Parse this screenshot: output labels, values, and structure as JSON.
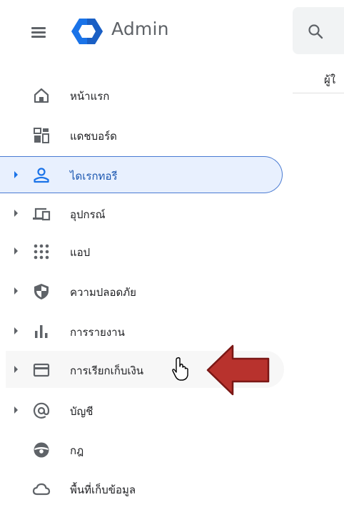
{
  "header": {
    "app_title": "Admin",
    "right_label": "ผู้ใ"
  },
  "sidebar": {
    "items": [
      {
        "label": "หน้าแรก",
        "icon": "home-icon",
        "expandable": false
      },
      {
        "label": "แดชบอร์ด",
        "icon": "dashboard-icon",
        "expandable": false
      },
      {
        "label": "ไดเรกทอรี",
        "icon": "person-icon",
        "expandable": true,
        "active": true
      },
      {
        "label": "อุปกรณ์",
        "icon": "devices-icon",
        "expandable": true
      },
      {
        "label": "แอป",
        "icon": "apps-grid-icon",
        "expandable": true
      },
      {
        "label": "ความปลอดภัย",
        "icon": "shield-icon",
        "expandable": true
      },
      {
        "label": "การรายงาน",
        "icon": "bar-chart-icon",
        "expandable": true
      },
      {
        "label": "การเรียกเก็บเงิน",
        "icon": "credit-card-icon",
        "expandable": true,
        "hovered": true
      },
      {
        "label": "บัญชี",
        "icon": "at-sign-icon",
        "expandable": true
      },
      {
        "label": "กฎ",
        "icon": "rules-icon",
        "expandable": false
      },
      {
        "label": "พื้นที่เก็บข้อมูล",
        "icon": "cloud-icon",
        "expandable": false
      }
    ]
  },
  "colors": {
    "active_bg": "#e8f0fe",
    "active_border": "#4a7bd2",
    "annotation_arrow": "#b8322d",
    "icon_gray": "#5f6368",
    "logo_blue": "#1a73e8"
  }
}
